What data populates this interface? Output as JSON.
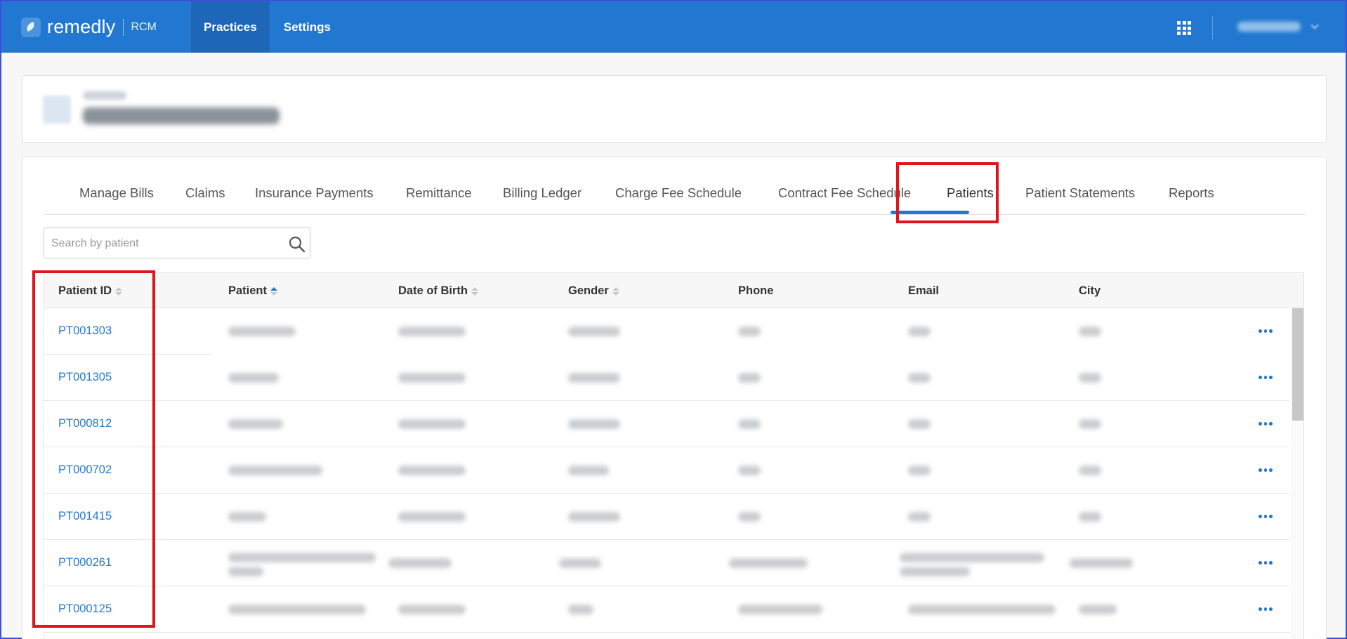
{
  "topbar": {
    "brand": "remedly",
    "brand_sub": "RCM",
    "nav": [
      {
        "label": "Practices",
        "active": true
      },
      {
        "label": "Settings",
        "active": false
      }
    ],
    "apps_icon": "grid-icon",
    "user_menu_icon": "chevron-down-icon"
  },
  "tabs": [
    {
      "label": "Manage Bills"
    },
    {
      "label": "Claims"
    },
    {
      "label": "Insurance Payments"
    },
    {
      "label": "Remittance"
    },
    {
      "label": "Billing Ledger"
    },
    {
      "label": "Charge Fee Schedule"
    },
    {
      "label": "Contract Fee Schedule"
    },
    {
      "label": "Patients",
      "active": true
    },
    {
      "label": "Patient Statements"
    },
    {
      "label": "Reports"
    }
  ],
  "search": {
    "placeholder": "Search by patient",
    "value": ""
  },
  "table": {
    "columns": [
      {
        "label": "Patient ID",
        "sortable": true,
        "sort": "none"
      },
      {
        "label": "Patient",
        "sortable": true,
        "sort": "asc"
      },
      {
        "label": "Date of Birth",
        "sortable": true,
        "sort": "none"
      },
      {
        "label": "Gender",
        "sortable": true,
        "sort": "none"
      },
      {
        "label": "Phone",
        "sortable": false
      },
      {
        "label": "Email",
        "sortable": false
      },
      {
        "label": "City",
        "sortable": false
      }
    ],
    "rows": [
      {
        "patient_id": "PT001303"
      },
      {
        "patient_id": "PT001305"
      },
      {
        "patient_id": "PT000812"
      },
      {
        "patient_id": "PT000702"
      },
      {
        "patient_id": "PT001415"
      },
      {
        "patient_id": "PT000261"
      },
      {
        "patient_id": "PT000125"
      }
    ]
  },
  "colors": {
    "brand": "#2278d0",
    "highlight": "#e0141b"
  }
}
